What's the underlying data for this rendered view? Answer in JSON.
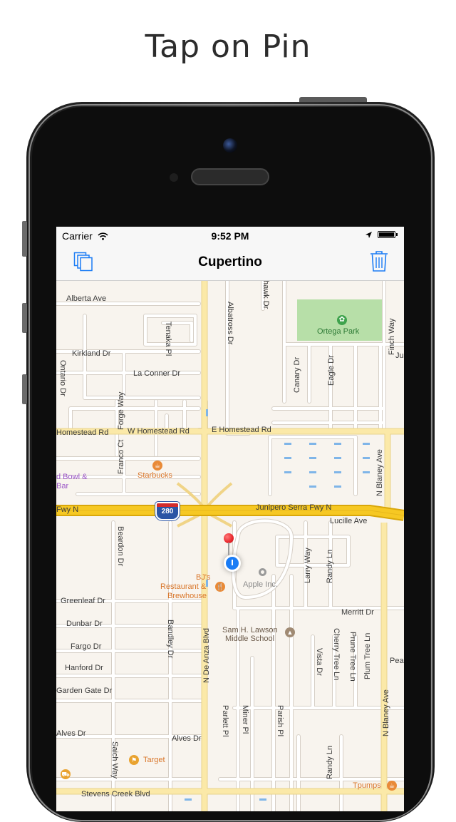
{
  "caption": "Tap on Pin",
  "status_bar": {
    "carrier": "Carrier",
    "time": "9:52 PM"
  },
  "nav": {
    "title": "Cupertino",
    "left_icon": "copy-icon",
    "right_icon": "trash-icon"
  },
  "map": {
    "streets": {
      "alberta_ave": "Alberta Ave",
      "tenaka_pl": "Tenaka Pl",
      "albatross_dr": "Albatross Dr",
      "hawk_dr": "hawk Dr",
      "finch_way": "Finch Way",
      "kirkland_dr": "Kirkland Dr",
      "la_conner_dr": "La Conner Dr",
      "ontario_dr": "Ontario Dr",
      "canary_dr": "Canary Dr",
      "eagle_dr": "Eagle Dr",
      "forge_way": "Forge Way",
      "w_homestead_rd_left": "Homestead Rd",
      "w_homestead_rd": "W Homestead Rd",
      "e_homestead_rd": "E Homestead Rd",
      "franco_ct": "Franco Ct",
      "n_blaney_ave_top": "N Blaney Ave",
      "fwy_n_left": "Fwy N",
      "junipero_serra_fwy_n": "Junipero Serra Fwy N",
      "lucille_ave": "Lucille Ave",
      "beardon_dr": "Beardon Dr",
      "larry_way": "Larry Way",
      "randy_ln_top": "Randy Ln",
      "greenleaf_dr": "Greenleaf Dr",
      "merritt_dr": "Merritt Dr",
      "dunbar_dr": "Dunbar Dr",
      "bandley_dr": "Bandley Dr",
      "n_de_anza_blvd": "N De Anza Blvd",
      "cherry_tree_ln": "Cherry Tree Ln",
      "prune_tree_ln": "Prune Tree Ln",
      "plum_tree_ln": "Plum Tree Ln",
      "vista_dr": "Vista Dr",
      "fargo_dr": "Fargo Dr",
      "hanford_dr": "Hanford Dr",
      "garden_gate_dr": "Garden Gate Dr",
      "parlett_pl": "Parlett Pl",
      "miner_pl": "Miner Pl",
      "parish_pl": "Parish Pl",
      "n_blaney_ave_bottom": "N Blaney Ave",
      "alves_dr_left": "Alves Dr",
      "alves_dr_right": "Alves Dr",
      "saich_way": "Saich Way",
      "randy_ln_bottom": "Randy Ln",
      "stevens_creek_blvd": "Stevens Creek Blvd",
      "pea": "Pea",
      "ju": "Ju"
    },
    "pois": {
      "ortega_park": "Ortega Park",
      "starbucks": "Starbucks",
      "bowl_line1": "d Bowl &",
      "bowl_line2": "Bar",
      "bjs_line1": "BJ's",
      "bjs_line2": "Restaurant &",
      "bjs_line3": "Brewhouse",
      "apple_inc": "Apple Inc.",
      "school_line1": "Sam H. Lawson",
      "school_line2": "Middle School",
      "target": "Target",
      "tpumps": "Tpumps"
    },
    "highway_shield": "280"
  },
  "colors": {
    "map_bg": "#f8f4ee",
    "street": "#ffffff",
    "street_edge": "#d9d3cb",
    "major_road": "#fbe9a8",
    "freeway": "#f4c51c",
    "park": "#b7dfa8",
    "poi_orange": "#e98a37",
    "tint_blue": "#1a7cf5",
    "pin_red": "#e8262b"
  }
}
